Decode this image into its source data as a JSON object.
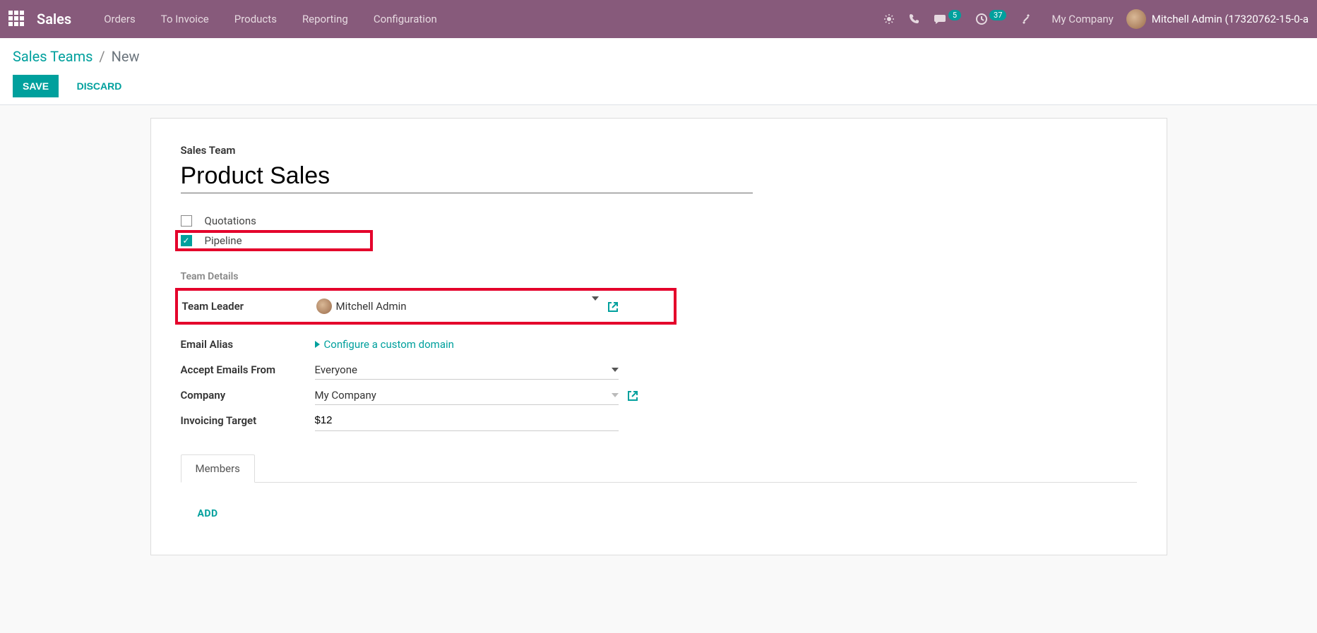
{
  "topbar": {
    "app": "Sales",
    "nav": [
      "Orders",
      "To Invoice",
      "Products",
      "Reporting",
      "Configuration"
    ],
    "chat_count": "5",
    "activity_count": "37",
    "company": "My Company",
    "user": "Mitchell Admin (17320762-15-0-a"
  },
  "breadcrumb": {
    "root": "Sales Teams",
    "sep": "/",
    "current": "New"
  },
  "buttons": {
    "save": "Save",
    "discard": "Discard"
  },
  "form": {
    "title_label": "Sales Team",
    "title_value": "Product Sales",
    "quotations_label": "Quotations",
    "pipeline_label": "Pipeline",
    "section_team_details": "Team Details",
    "team_leader_label": "Team Leader",
    "team_leader_value": "Mitchell Admin",
    "email_alias_label": "Email Alias",
    "configure_domain": "Configure a custom domain",
    "accept_from_label": "Accept Emails From",
    "accept_from_value": "Everyone",
    "company_label": "Company",
    "company_value": "My Company",
    "invoicing_label": "Invoicing Target",
    "invoicing_value": "$12",
    "tab_members": "Members",
    "add_label": "ADD"
  }
}
